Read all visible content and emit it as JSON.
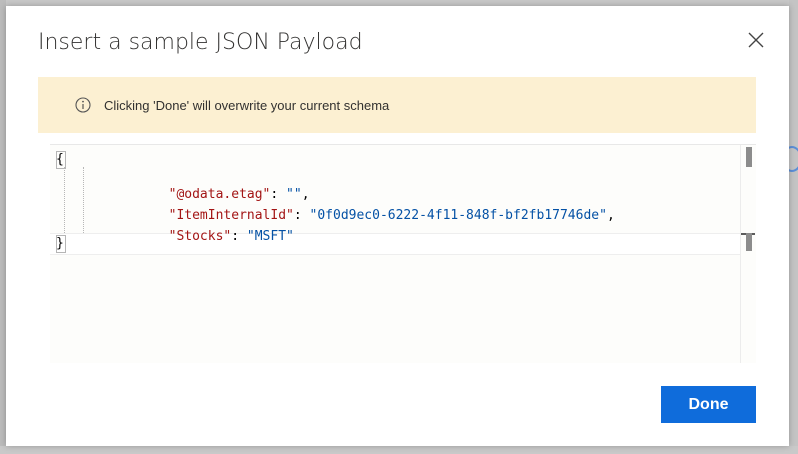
{
  "dialog": {
    "title": "Insert a sample JSON Payload",
    "close_icon": "close-icon",
    "warning": {
      "icon": "info-icon",
      "text": "Clicking 'Done' will overwrite your current schema"
    },
    "editor": {
      "open_brace": "{",
      "close_brace": "}",
      "lines": [
        {
          "key": "\"@odata.etag\"",
          "sep": ": ",
          "value": "\"\"",
          "tail": ","
        },
        {
          "key": "\"ItemInternalId\"",
          "sep": ": ",
          "value": "\"0f0d9ec0-6222-4f11-848f-bf2fb17746de\"",
          "tail": ","
        },
        {
          "key": "\"Stocks\"",
          "sep": ": ",
          "value": "\"MSFT\"",
          "tail": ""
        }
      ]
    },
    "done_label": "Done"
  },
  "colors": {
    "accent": "#0f6cdb",
    "warning_bg": "#fcf0d2",
    "json_key": "#a31515",
    "json_value": "#0451a5"
  }
}
